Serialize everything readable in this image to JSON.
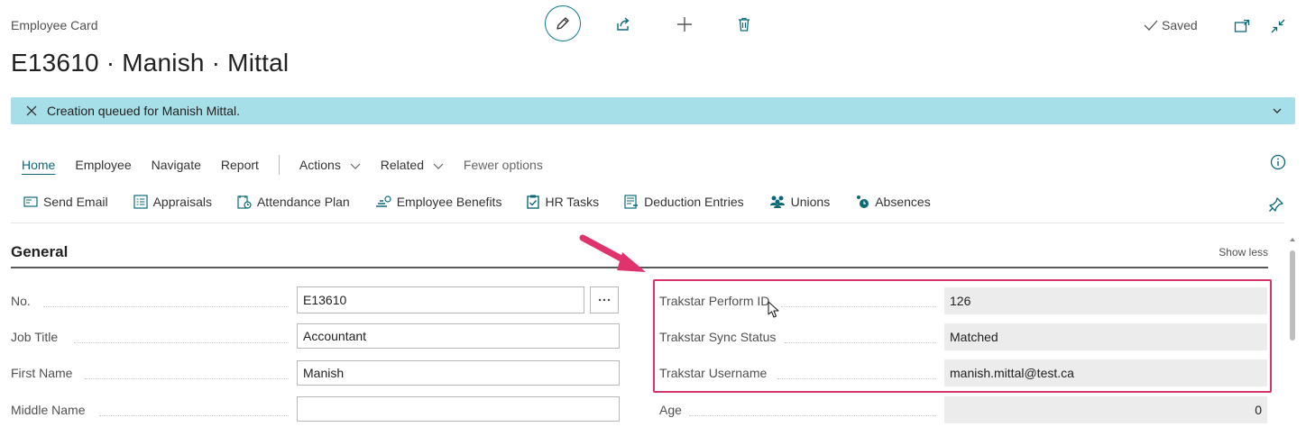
{
  "header": {
    "caption": "Employee Card",
    "title": "E13610 · Manish · Mittal",
    "saved_label": "Saved"
  },
  "banner": {
    "message": "Creation queued for Manish Mittal."
  },
  "tabs": [
    {
      "label": "Home"
    },
    {
      "label": "Employee"
    },
    {
      "label": "Navigate"
    },
    {
      "label": "Report"
    },
    {
      "label": "Actions"
    },
    {
      "label": "Related"
    },
    {
      "label": "Fewer options"
    }
  ],
  "actions": [
    {
      "label": "Send Email"
    },
    {
      "label": "Appraisals"
    },
    {
      "label": "Attendance Plan"
    },
    {
      "label": "Employee Benefits"
    },
    {
      "label": "HR Tasks"
    },
    {
      "label": "Deduction Entries"
    },
    {
      "label": "Unions"
    },
    {
      "label": "Absences"
    }
  ],
  "section": {
    "title": "General",
    "show_less": "Show less"
  },
  "left_fields": [
    {
      "label": "No.",
      "value": "E13610"
    },
    {
      "label": "Job Title",
      "value": "Accountant"
    },
    {
      "label": "First Name",
      "value": "Manish"
    },
    {
      "label": "Middle Name",
      "value": ""
    }
  ],
  "right_fields": [
    {
      "label": "Trakstar Perform ID",
      "value": "126"
    },
    {
      "label": "Trakstar Sync Status",
      "value": "Matched"
    },
    {
      "label": "Trakstar Username",
      "value": "manish.mittal@test.ca"
    },
    {
      "label": "Age",
      "value": "0"
    }
  ],
  "colors": {
    "accent": "#0b7a86",
    "banner": "#a7dfe8",
    "highlight": "#d6336c",
    "arrow": "#e0336e"
  }
}
